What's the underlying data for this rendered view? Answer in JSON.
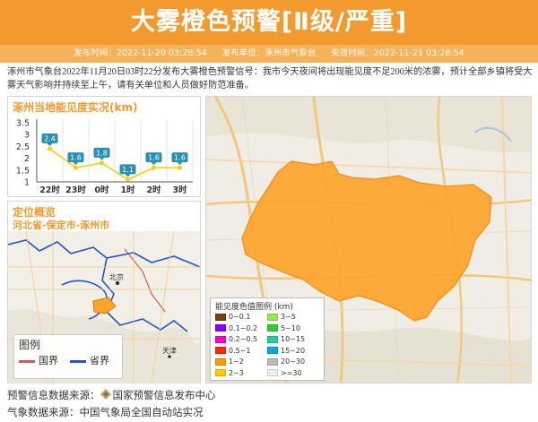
{
  "header": {
    "title": "大雾橙色预警[Ⅱ级/严重]",
    "issue_time": "发布时间：2022-11-20 03:28:54",
    "issuer": "发布单位：涿州市气象台",
    "expire_time": "失效时间：2022-11-21 03:28:54"
  },
  "message": "涿州市气象台2022年11月20日03时22分发布大雾橙色预警信号：我市今天夜间将出现能见度不足200米的浓雾，预计全部乡镇将受大雾天气影响并持续至上午，请有关单位和人员做好防范准备。",
  "visibility_panel": {
    "title": "涿州当地能见度实况(km)"
  },
  "chart_data": {
    "type": "line",
    "categories": [
      "22时",
      "23时",
      "0时",
      "1时",
      "2时",
      "3时"
    ],
    "values": [
      2.4,
      1.6,
      1.8,
      1.1,
      1.6,
      1.6
    ],
    "title": "涿州当地能见度实况(km)",
    "xlabel": "",
    "ylabel": "",
    "ylim": [
      1,
      3.5
    ],
    "yticks": [
      "1",
      "1.5",
      "2",
      "2.5",
      "3",
      "3.5"
    ],
    "series_color": "#f5d000",
    "label_color": "#2b8fb0",
    "grid": "vertical"
  },
  "location_panel": {
    "title": "定位概览",
    "region": "河北省-保定市-涿州市",
    "map_labels": {
      "beijing": "北京",
      "tianjin": "天津"
    },
    "legend_title": "图例",
    "legend_country": "国界",
    "legend_province": "省界",
    "country_color": "#c0606a",
    "province_color": "#2255cc"
  },
  "color_legend": {
    "title": "能见度色值图例 (km)",
    "items": [
      {
        "label": "0~0.1",
        "color": "#7b3f00"
      },
      {
        "label": "0.1~0.2",
        "color": "#8b00ff"
      },
      {
        "label": "0.2~0.5",
        "color": "#ff00c8"
      },
      {
        "label": "0.5~1",
        "color": "#ff2a00"
      },
      {
        "label": "1~2",
        "color": "#ff9900"
      },
      {
        "label": "2~3",
        "color": "#ffcc00"
      },
      {
        "label": "3~5",
        "color": "#99e64d"
      },
      {
        "label": "5~10",
        "color": "#33cc33"
      },
      {
        "label": "10~15",
        "color": "#22ccaa"
      },
      {
        "label": "15~20",
        "color": "#00aadd"
      },
      {
        "label": "20~30",
        "color": "#bbbbbb"
      },
      {
        "label": ">=30",
        "color": "#eeeeee"
      }
    ]
  },
  "footer": {
    "source_label": "预警信息数据来源：",
    "source_value": "国家预警信息发布中心",
    "weather_label": "气象数据来源：",
    "weather_value": "中国气象局全国自动站实况"
  },
  "colors": {
    "accent": "#f29a2e",
    "warning_area": "#ffa42b"
  }
}
